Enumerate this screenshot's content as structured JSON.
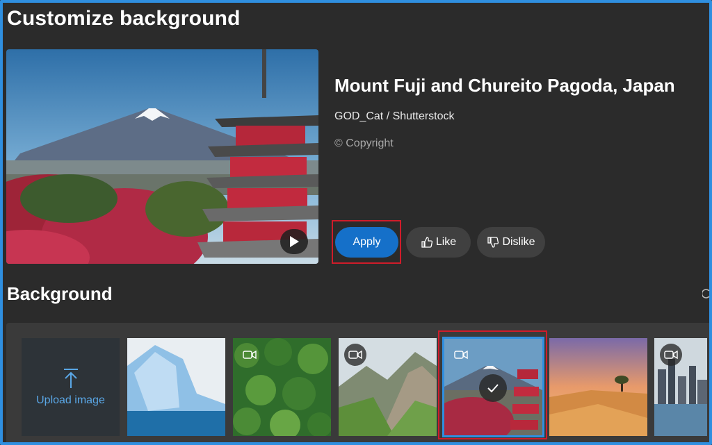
{
  "page": {
    "title": "Customize background"
  },
  "preview": {
    "image_desc": "Mount Fuji and Chureito Pagoda preview",
    "play_icon": "play-icon"
  },
  "info": {
    "title": "Mount Fuji and Chureito Pagoda, Japan",
    "credit": "GOD_Cat / Shutterstock",
    "copyright": "© Copyright"
  },
  "actions": {
    "apply_label": "Apply",
    "like_label": "Like",
    "dislike_label": "Dislike"
  },
  "background": {
    "section_title": "Background",
    "upload_label": "Upload image",
    "thumbnails": [
      {
        "name": "iceberg",
        "video": false,
        "selected": false
      },
      {
        "name": "forest-aerial",
        "video": true,
        "selected": false
      },
      {
        "name": "mountain-valley",
        "video": true,
        "selected": false
      },
      {
        "name": "mount-fuji-pagoda",
        "video": true,
        "selected": true
      },
      {
        "name": "desert-dunes",
        "video": false,
        "selected": false
      },
      {
        "name": "city-skyline",
        "video": true,
        "selected": false
      }
    ]
  },
  "colors": {
    "accent": "#1570c9",
    "highlight": "#d01c2a",
    "selection": "#2f8fe0",
    "background": "#2b2b2b"
  }
}
